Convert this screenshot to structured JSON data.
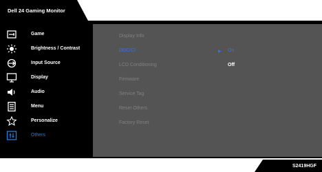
{
  "header": {
    "title": "Dell 24 Gaming Monitor"
  },
  "colors": {
    "accent": "#2a7ae2",
    "panel_bg": "#000000",
    "content_bg": "#545454",
    "disabled_text": "#808080"
  },
  "nav": [
    {
      "label": "Game",
      "icon": "gamepad-icon",
      "active": false
    },
    {
      "label": "Brightness / Contrast",
      "icon": "brightness-icon",
      "active": false
    },
    {
      "label": "Input Source",
      "icon": "input-source-icon",
      "active": false
    },
    {
      "label": "Display",
      "icon": "display-icon",
      "active": false
    },
    {
      "label": "Audio",
      "icon": "speaker-icon",
      "active": false
    },
    {
      "label": "Menu",
      "icon": "menu-icon",
      "active": false
    },
    {
      "label": "Personalize",
      "icon": "star-icon",
      "active": false
    },
    {
      "label": "Others",
      "icon": "others-icon",
      "active": true
    }
  ],
  "options": [
    {
      "label": "Display Info"
    },
    {
      "label": "DDC/CI",
      "selected": true
    },
    {
      "label": "LCD Conditioning"
    },
    {
      "label": "Firmware"
    },
    {
      "label": "Service Tag"
    },
    {
      "label": "Reset Others"
    },
    {
      "label": "Factory Reset"
    }
  ],
  "ddc_values": [
    {
      "label": "On",
      "selected": true,
      "marker": "▶"
    },
    {
      "label": "Off",
      "selected": false
    }
  ],
  "footer": {
    "model": "S2419HGF"
  }
}
